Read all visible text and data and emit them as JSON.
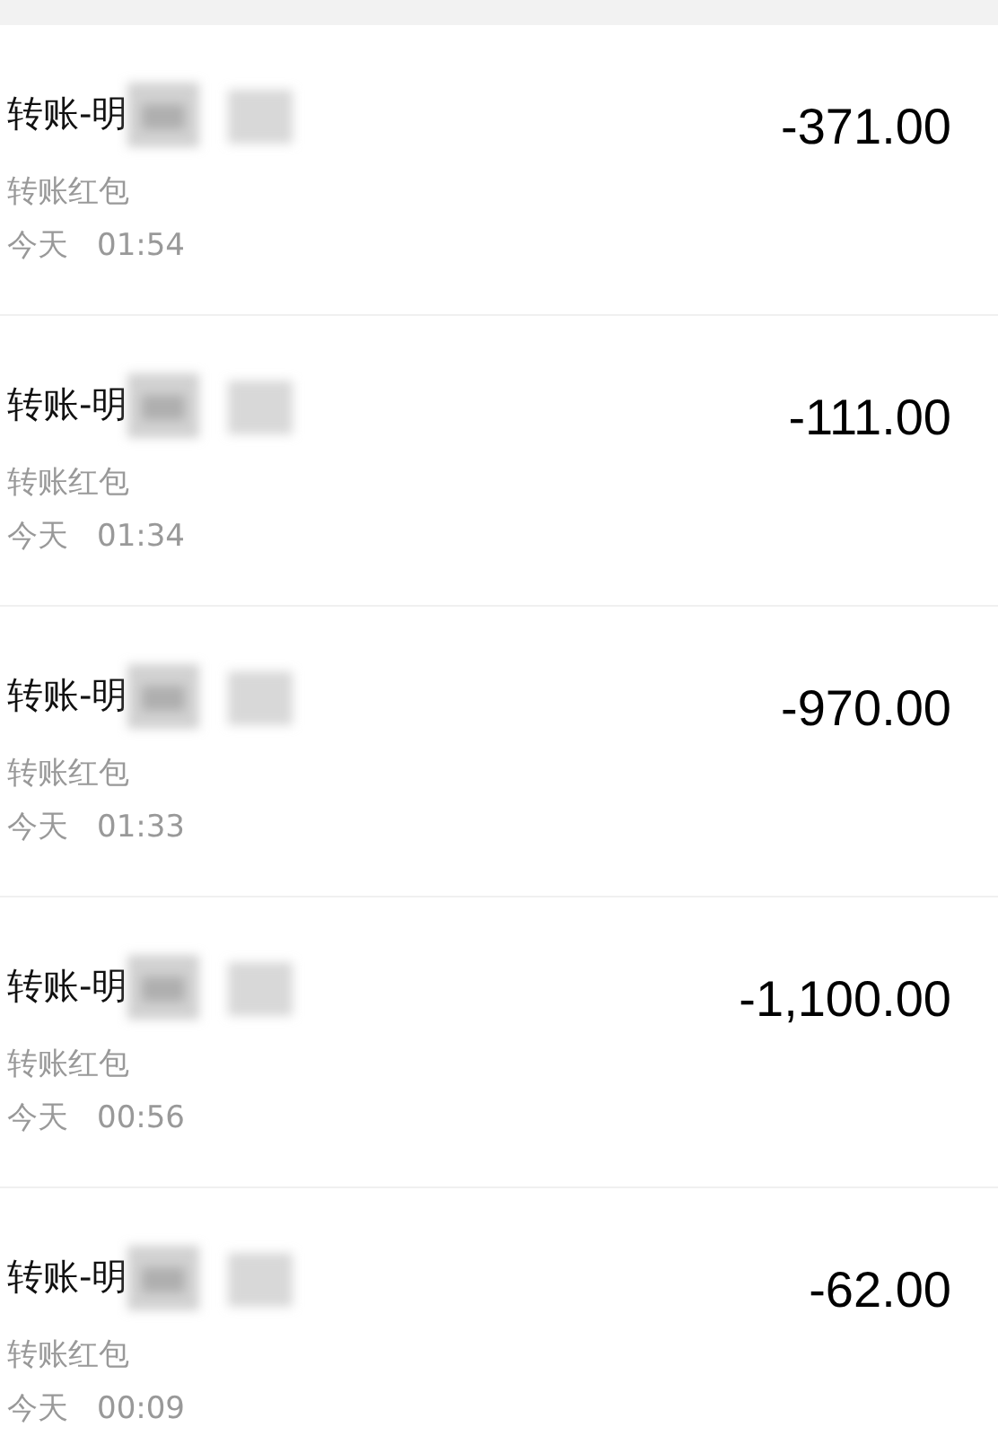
{
  "transactions": [
    {
      "title": "转账-明",
      "category": "转账红包",
      "day": "今天",
      "time": "01:54",
      "amount": "-371.00"
    },
    {
      "title": "转账-明",
      "category": "转账红包",
      "day": "今天",
      "time": "01:34",
      "amount": "-111.00"
    },
    {
      "title": "转账-明",
      "category": "转账红包",
      "day": "今天",
      "time": "01:33",
      "amount": "-970.00"
    },
    {
      "title": "转账-明",
      "category": "转账红包",
      "day": "今天",
      "time": "00:56",
      "amount": "-1,100.00"
    },
    {
      "title": "转账-明",
      "category": "转账红包",
      "day": "今天",
      "time": "00:09",
      "amount": "-62.00"
    }
  ]
}
